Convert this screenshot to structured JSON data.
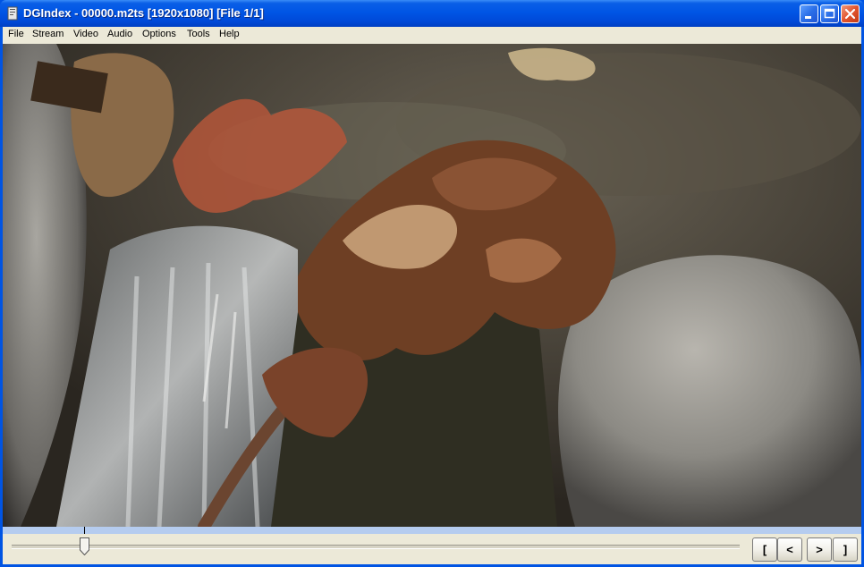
{
  "window": {
    "title": "DGIndex - 00000.m2ts [1920x1080] [File 1/1]"
  },
  "menu": {
    "items": [
      "File",
      "Stream",
      "Video",
      "Audio",
      "Options",
      "Tools",
      "Help"
    ]
  },
  "video": {
    "content": "autumn-leaves-stream-frame"
  },
  "controls": {
    "playback_position_fraction": 0.1,
    "buttons": {
      "mark_start": "[",
      "prev": "<",
      "next": ">",
      "mark_end": "]"
    }
  },
  "colors": {
    "titlebar": "#0055e5",
    "close_button": "#e2542e",
    "chrome": "#ece9d8",
    "progress_track": "#b5ccef"
  },
  "icons": {
    "app": "dgindex-app-icon",
    "minimize": "minimize-icon",
    "maximize": "maximize-icon",
    "close": "close-icon"
  }
}
